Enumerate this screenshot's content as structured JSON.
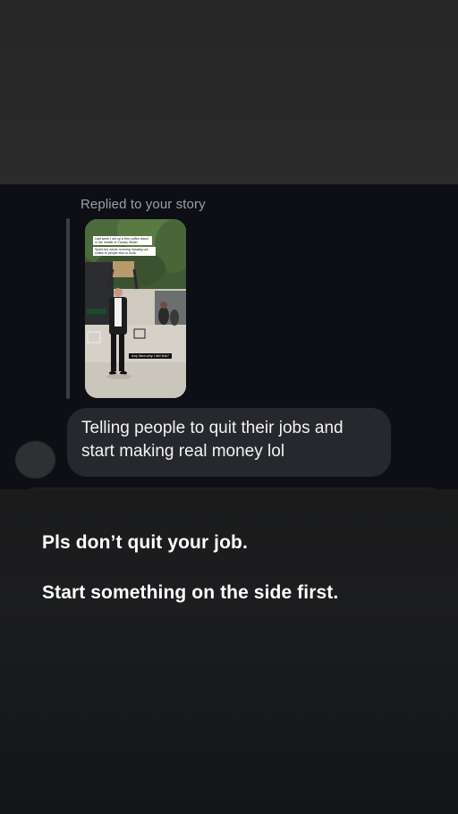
{
  "dm": {
    "reply_label": "Replied to your story",
    "story_captions": {
      "caption_1": "Last week I set up a free coffee stand in the middle of Canary Wharf.",
      "caption_2": "Spent the whole morning handing out coffee to people else to work.",
      "caption_3": "Any idea why I did this?"
    },
    "message": "Telling people to quit their jobs and start making real money lol"
  },
  "overlay": {
    "line_1": "Pls don’t quit your job.",
    "line_2": "Start something on the side first."
  },
  "colors": {
    "dm_background": "#0d0f14",
    "bubble": "#26282d",
    "page_background": "#2a2a2a",
    "overlay_text": "#ffffff"
  }
}
